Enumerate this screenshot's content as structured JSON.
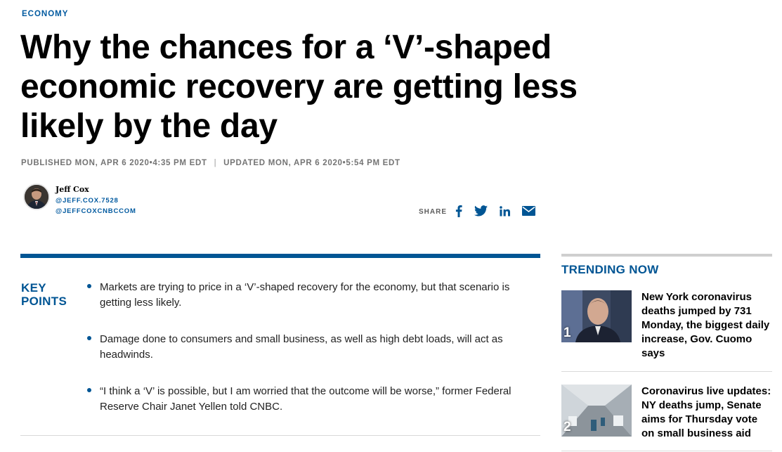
{
  "article": {
    "section": "ECONOMY",
    "headline": "Why the chances for a ‘V’-shaped economic recovery are getting less likely by the day",
    "published": "PUBLISHED MON, APR 6 2020•4:35 PM EDT",
    "separator": "|",
    "updated": "UPDATED MON, APR 6 2020•5:54 PM EDT"
  },
  "author": {
    "name": "Jeff Cox",
    "handle_1": "@JEFF.COX.7528",
    "handle_2": "@JEFFCOXCNBCCOM"
  },
  "share": {
    "label": "SHARE",
    "icons": [
      "facebook-icon",
      "twitter-icon",
      "linkedin-icon",
      "email-icon"
    ],
    "color": "#005594"
  },
  "key_points": {
    "title_line1": "KEY",
    "title_line2": "POINTS",
    "items": [
      "Markets are trying to price in a ‘V’-shaped recovery for the economy, but that scenario is getting less likely.",
      "Damage done to consumers and small business, as well as high debt loads, will act as headwinds.",
      "“I think a ‘V’ is possible, but I am worried that the outcome will be worse,”  former Federal Reserve Chair Janet Yellen told CNBC."
    ]
  },
  "trending": {
    "title": "TRENDING NOW",
    "items": [
      {
        "rank": "1",
        "headline": "New York coronavirus deaths jumped by 731 Monday, the biggest daily increase, Gov. Cuomo says"
      },
      {
        "rank": "2",
        "headline": "Coronavirus live updates: NY deaths jump, Senate aims for Thursday vote on small business aid"
      }
    ]
  },
  "colors": {
    "brand_blue": "#005594",
    "section_blue": "#00599f",
    "meta_gray": "#747474"
  }
}
